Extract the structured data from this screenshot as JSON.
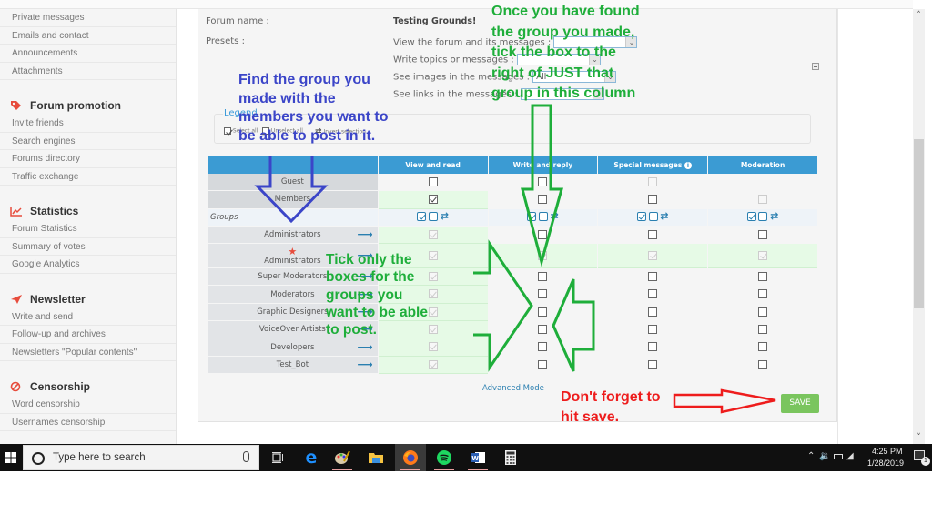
{
  "sidebar": {
    "top_items": [
      "Private messages",
      "Emails and contact",
      "Announcements",
      "Attachments"
    ],
    "sections": [
      {
        "title": "Forum promotion",
        "icon": "tag-icon",
        "items": [
          "Invite friends",
          "Search engines",
          "Forums directory",
          "Traffic exchange"
        ]
      },
      {
        "title": "Statistics",
        "icon": "chart-icon",
        "items": [
          "Forum Statistics",
          "Summary of votes",
          "Google Analytics"
        ]
      },
      {
        "title": "Newsletter",
        "icon": "paper-plane-icon",
        "items": [
          "Write and send",
          "Follow-up and archives",
          "Newsletters \"Popular contents\""
        ]
      },
      {
        "title": "Censorship",
        "icon": "ban-icon",
        "items": [
          "Word censorship",
          "Usernames censorship"
        ]
      }
    ]
  },
  "form": {
    "forum_name_label": "Forum name :",
    "forum_name_value": "Testing Grounds!",
    "presets_label": "Presets :",
    "presets": [
      {
        "label": "View the forum and its messages :",
        "value": ""
      },
      {
        "label": "Write topics or messages :",
        "value": ""
      },
      {
        "label": "See images in the messages :",
        "value": "All"
      },
      {
        "label": "See links in the messages :",
        "value": ""
      }
    ]
  },
  "legend": {
    "title": "Legend",
    "select_all": "Select all",
    "unselect_all": "Unselect all",
    "invert_selection": "Invert selection"
  },
  "table": {
    "columns": [
      "",
      "View and read",
      "Write and reply",
      "Special messages",
      "Moderation"
    ],
    "groups_label": "Groups",
    "base_rows": [
      {
        "name": "Guest",
        "view": "unchecked",
        "write": "unchecked",
        "special": "disabled",
        "moderation": "none"
      },
      {
        "name": "Members",
        "view": "checked",
        "write": "unchecked",
        "special": "unchecked",
        "moderation": "disabled"
      }
    ],
    "group_rows": [
      {
        "name": "Administrators",
        "star": false,
        "view": "disabled-checked",
        "write": "unchecked",
        "special": "unchecked",
        "moderation": "unchecked"
      },
      {
        "name": "Administrators",
        "star": true,
        "view": "disabled-checked",
        "write": "disabled-checked",
        "special": "disabled-checked",
        "moderation": "disabled-checked"
      },
      {
        "name": "Super Moderators",
        "star": false,
        "view": "disabled-checked",
        "write": "unchecked",
        "special": "unchecked",
        "moderation": "unchecked"
      },
      {
        "name": "Moderators",
        "star": false,
        "view": "disabled-checked",
        "write": "unchecked",
        "special": "unchecked",
        "moderation": "unchecked"
      },
      {
        "name": "Graphic Designers",
        "star": false,
        "view": "disabled-checked",
        "write": "unchecked",
        "special": "unchecked",
        "moderation": "unchecked"
      },
      {
        "name": "VoiceOver Artists",
        "star": false,
        "view": "disabled-checked",
        "write": "unchecked",
        "special": "unchecked",
        "moderation": "unchecked"
      },
      {
        "name": "Developers",
        "star": false,
        "view": "disabled-checked",
        "write": "unchecked",
        "special": "unchecked",
        "moderation": "unchecked"
      },
      {
        "name": "Test_Bot",
        "star": false,
        "view": "disabled-checked",
        "write": "unchecked",
        "special": "unchecked",
        "moderation": "unchecked"
      }
    ]
  },
  "footer": {
    "advanced_mode": "Advanced Mode",
    "save": "SAVE"
  },
  "annotations": {
    "blue": [
      "Find the group you",
      "made with the",
      "members you want to",
      "be able to post in it."
    ],
    "green_top": [
      "Once you have found",
      "the group you made,",
      "tick the box to the",
      "right of JUST that",
      "group in this column"
    ],
    "green_mid": [
      "Tick only the",
      "boxes for the",
      "groups you",
      "want to be able",
      "to post."
    ],
    "red": [
      "Don't forget to",
      "hit save."
    ],
    "colors": {
      "blue": "#3b45c8",
      "green": "#1eae3a",
      "red": "#ee1c1c"
    }
  },
  "taskbar": {
    "search_placeholder": "Type here to search",
    "apps": [
      "task-view",
      "edge",
      "paint",
      "file-explorer",
      "firefox",
      "spotify",
      "word",
      "calculator"
    ],
    "active_app": "firefox",
    "time": "4:25 PM",
    "date": "1/28/2019",
    "notification_count": "1"
  }
}
